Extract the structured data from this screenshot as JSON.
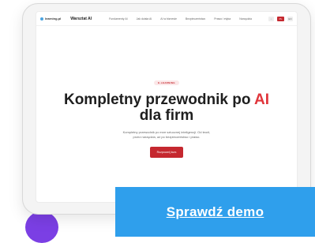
{
  "screen": {
    "logo_text": "learning.pl",
    "brand": "Warsztat AI",
    "nav": [
      "Fundamenty AI",
      "Jak działa AI",
      "AI w biznesie",
      "Bezpieczeństwo",
      "Prawo i etyka",
      "Narzędzia"
    ],
    "nav_icon_label": "☼",
    "nav_cta_label": "PL",
    "nav_lang_label": "EN"
  },
  "hero": {
    "badge": "E-LEARNING",
    "title_main": "Kompletny przewodnik po ",
    "title_accent": "AI",
    "title_line2": "dla firm",
    "subtitle_line1": "Kompletny przewodnik po erze sztucznej inteligencji. Od teorii,",
    "subtitle_line2": "przez narzędzia, aż po bezpieczeństwo i prawo.",
    "button": "Rozpocznij kurs"
  },
  "cta": {
    "label": "Sprawdź demo"
  },
  "colors": {
    "accent_red": "#c5282f",
    "cta_blue": "#2f9fec",
    "blob_blue": "#7ec8f5",
    "blob_purple": "#7b3fe4"
  }
}
